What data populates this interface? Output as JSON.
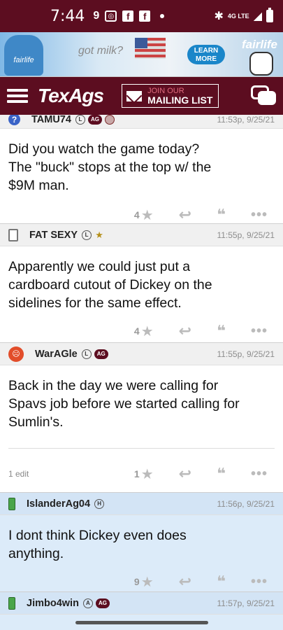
{
  "status_bar": {
    "time": "7:44",
    "network": "4G LTE"
  },
  "ad": {
    "got_milk": "got milk?",
    "cta": "LEARN MORE",
    "brand": "fairlife",
    "bottle_label": "fairlife"
  },
  "nav": {
    "logo": "TexAgs",
    "join": "JOIN OUR",
    "mailing": "MAILING LIST"
  },
  "posts": [
    {
      "user": "TAMU74",
      "badges": [
        "L",
        "AG"
      ],
      "time": "11:53p, 9/25/21",
      "text_lines": [
        "Did you watch the game today?",
        "The \"buck\" stops at the top w/ the",
        "$9M man."
      ],
      "votes": "4",
      "edit": ""
    },
    {
      "user": "FAT SEXY",
      "badges": [
        "L",
        "★"
      ],
      "time": "11:55p, 9/25/21",
      "text_lines": [
        "Apparently we could just put a",
        "cardboard cutout of Dickey on the",
        "sidelines for the same effect."
      ],
      "votes": "4",
      "edit": ""
    },
    {
      "user": "WarAGle",
      "badges": [
        "L",
        "AG"
      ],
      "time": "11:55p, 9/25/21",
      "text_lines": [
        "Back in the day we were calling for",
        "Spavs job before we started calling for",
        "Sumlin's."
      ],
      "votes": "1",
      "edit": "1 edit"
    },
    {
      "user": "IslanderAg04",
      "badges": [
        "H"
      ],
      "time": "11:56p, 9/25/21",
      "text_lines": [
        "I dont think Dickey even does",
        "anything."
      ],
      "votes": "9",
      "edit": ""
    },
    {
      "user": "Jimbo4win",
      "badges": [
        "A",
        "AG"
      ],
      "time": "11:57p, 9/25/21",
      "text_lines": [],
      "votes": "",
      "edit": ""
    }
  ],
  "colors": {
    "maroon": "#5c0d20",
    "highlight": "#dcebf9"
  }
}
